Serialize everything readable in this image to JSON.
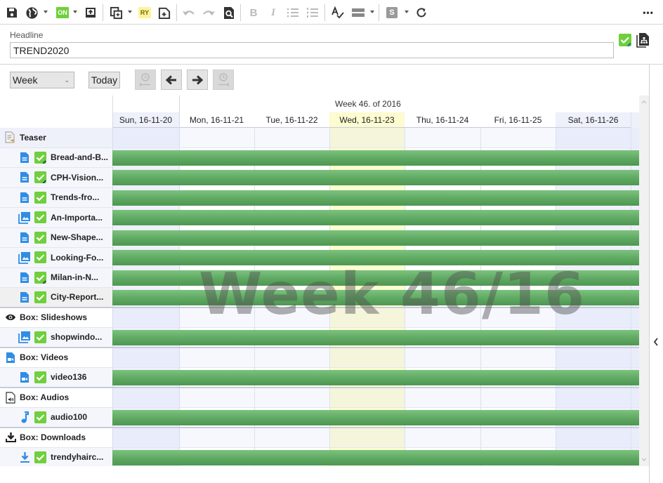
{
  "toolbar": {
    "buttons": [
      {
        "name": "save",
        "icon": "save-icon"
      },
      {
        "name": "publish-globe",
        "icon": "globe-icon"
      },
      {
        "name": "status-on",
        "icon": "on-badge-icon",
        "label": "ON"
      },
      {
        "name": "import",
        "icon": "import-icon"
      },
      {
        "name": "copy",
        "icon": "copy-icon"
      },
      {
        "name": "ready",
        "icon": "ry-badge-icon",
        "label": "RY"
      },
      {
        "name": "new-document",
        "icon": "new-doc-icon"
      },
      {
        "name": "undo",
        "icon": "undo-icon"
      },
      {
        "name": "redo",
        "icon": "redo-icon"
      },
      {
        "name": "preview",
        "icon": "preview-icon"
      },
      {
        "name": "bold",
        "icon": "bold-icon",
        "label": "B"
      },
      {
        "name": "italic",
        "icon": "italic-icon",
        "label": "I"
      },
      {
        "name": "bullet-list",
        "icon": "bullet-list-icon"
      },
      {
        "name": "numbered-list",
        "icon": "numbered-list-icon"
      },
      {
        "name": "spellcheck",
        "icon": "spellcheck-icon"
      },
      {
        "name": "layout",
        "icon": "layout-icon"
      },
      {
        "name": "style",
        "icon": "s-badge-icon",
        "label": "S"
      },
      {
        "name": "refresh",
        "icon": "refresh-icon"
      },
      {
        "name": "more",
        "icon": "more-icon",
        "label": "•••"
      }
    ]
  },
  "headline": {
    "label": "Headline",
    "value": "TREND2020"
  },
  "controls": {
    "view_select": "Week",
    "today_label": "Today"
  },
  "calendar": {
    "week_title": "Week 46. of 2016",
    "watermark": "Week 46/16",
    "today_index": 3,
    "days": [
      {
        "label": "Sun, 16-11-20",
        "weekend": true
      },
      {
        "label": "Mon, 16-11-21",
        "weekend": false
      },
      {
        "label": "Tue, 16-11-22",
        "weekend": false
      },
      {
        "label": "Wed, 16-11-23",
        "weekend": false
      },
      {
        "label": "Thu, 16-11-24",
        "weekend": false
      },
      {
        "label": "Fri, 16-11-25",
        "weekend": false
      },
      {
        "label": "Sat, 16-11-26",
        "weekend": true
      }
    ],
    "groups": [
      {
        "label": "Teaser",
        "icon": "teaser-icon",
        "items": [
          {
            "label": "Bread-and-B...",
            "icon": "document-icon",
            "edited": true
          },
          {
            "label": "CPH-Vision...",
            "icon": "document-icon",
            "edited": true
          },
          {
            "label": "Trends-fro...",
            "icon": "document-icon",
            "edited": false
          },
          {
            "label": "An-Importa...",
            "icon": "gallery-icon",
            "edited": false
          },
          {
            "label": "New-Shape...",
            "icon": "document-icon",
            "edited": false
          },
          {
            "label": "Looking-Fo...",
            "icon": "gallery-icon",
            "edited": false
          },
          {
            "label": "Milan-in-N...",
            "icon": "document-icon",
            "edited": true
          },
          {
            "label": "City-Report...",
            "icon": "document-icon",
            "edited": false
          }
        ]
      },
      {
        "label": "Box: Slideshows",
        "icon": "eye-icon",
        "items": [
          {
            "label": "shopwindo...",
            "icon": "gallery-icon",
            "edited": false
          }
        ]
      },
      {
        "label": "Box: Videos",
        "icon": "video-file-icon",
        "items": [
          {
            "label": "video136",
            "icon": "video-file-icon",
            "edited": false
          }
        ]
      },
      {
        "label": "Box: Audios",
        "icon": "audio-file-icon",
        "items": [
          {
            "label": "audio100",
            "icon": "music-note-icon",
            "edited": false
          }
        ]
      },
      {
        "label": "Box: Downloads",
        "icon": "download-icon",
        "items": [
          {
            "label": "trendyhairc...",
            "icon": "download-icon",
            "edited": false
          }
        ]
      }
    ]
  },
  "colors": {
    "bar": "#5ea962",
    "today": "#fdfbd0",
    "weekend": "#eef0fb",
    "check": "#6fcf3c",
    "doc_icon": "#2f8de4"
  }
}
